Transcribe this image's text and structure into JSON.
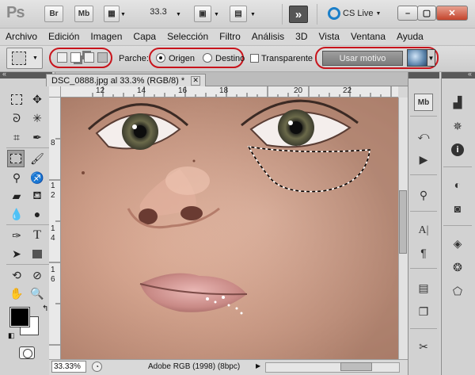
{
  "app": {
    "logo": "Ps",
    "bridge_label": "Br",
    "minibridge_label": "Mb",
    "zoom_value": "33.3",
    "cs_live_label": "CS Live"
  },
  "menu": [
    "Archivo",
    "Edición",
    "Imagen",
    "Capa",
    "Selección",
    "Filtro",
    "Análisis",
    "3D",
    "Vista",
    "Ventana",
    "Ayuda"
  ],
  "options": {
    "patch_label": "Parche:",
    "source_label": "Origen",
    "destination_label": "Destino",
    "selected_mode": "Origen",
    "transparent_label": "Transparente",
    "transparent_checked": false,
    "use_pattern_label": "Usar motivo"
  },
  "document": {
    "tab_title": "DSC_0888.jpg al 33.3% (RGB/8) *",
    "close_symbol": "✕",
    "ruler_top_ticks": [
      "12",
      "14",
      "16",
      "18",
      "20",
      "22"
    ],
    "ruler_left_ticks": [
      "8",
      "1",
      "2",
      "1",
      "4",
      "1",
      "6"
    ],
    "zoom_field": "33.33%",
    "color_profile": "Adobe RGB (1998) (8bpc)"
  },
  "tools": [
    "marquee",
    "move",
    "lasso",
    "magic-wand",
    "crop",
    "eyedropper",
    "patch",
    "brush",
    "clone-stamp",
    "history-brush",
    "eraser",
    "paint-bucket",
    "blur",
    "dodge",
    "pen",
    "type",
    "path-selection",
    "rectangle",
    "3d-rotate",
    "3d-orbit",
    "hand",
    "zoom"
  ],
  "panels_col1": [
    "minibridge",
    "history",
    "actions",
    "clone-source",
    "character",
    "paragraph",
    "notes",
    "layer-comps",
    "tool-presets"
  ],
  "panels_col2": [
    "histogram",
    "navigator",
    "info",
    "adjustments",
    "masks",
    "layers",
    "channels",
    "paths"
  ],
  "colors": {
    "accent_ring": "#c8141c",
    "foreground": "#000000",
    "background": "#ffffff",
    "panel_header": "#595959"
  }
}
